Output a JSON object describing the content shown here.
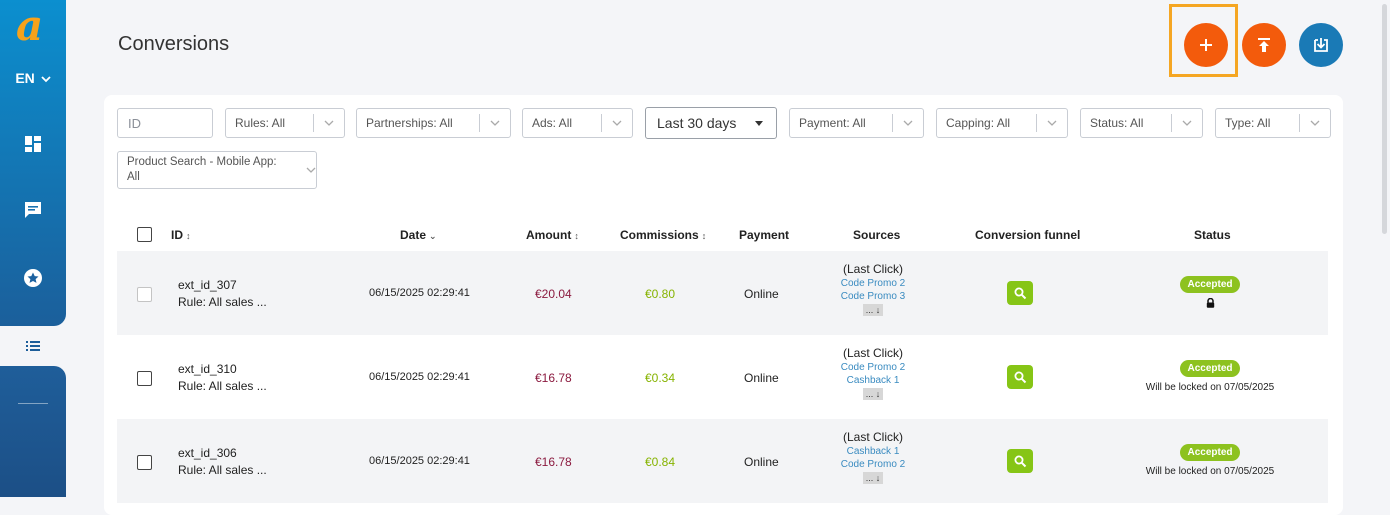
{
  "sidebar": {
    "language": "EN"
  },
  "header": {
    "title": "Conversions"
  },
  "filters": {
    "id_placeholder": "ID",
    "rules": "Rules: All",
    "partnerships": "Partnerships: All",
    "ads": "Ads: All",
    "date_range": "Last 30 days",
    "payment": "Payment: All",
    "capping": "Capping: All",
    "status": "Status: All",
    "type": "Type: All",
    "product_search_line1": "Product Search - Mobile App:",
    "product_search_line2": "All"
  },
  "table": {
    "columns": {
      "id": "ID",
      "date": "Date",
      "amount": "Amount",
      "commissions": "Commissions",
      "payment": "Payment",
      "sources": "Sources",
      "funnel": "Conversion funnel",
      "status": "Status"
    },
    "rows": [
      {
        "id": "ext_id_307",
        "rule": "Rule: All sales ...",
        "date": "06/15/2025 02:29:41",
        "amount": "€20.04",
        "commission": "€0.80",
        "payment": "Online",
        "source_head": "(Last Click)",
        "source_1": "Code Promo 2",
        "source_2": "Code Promo 3",
        "more": "... ↓",
        "status": "Accepted",
        "lock_note": ""
      },
      {
        "id": "ext_id_310",
        "rule": "Rule: All sales ...",
        "date": "06/15/2025 02:29:41",
        "amount": "€16.78",
        "commission": "€0.34",
        "payment": "Online",
        "source_head": "(Last Click)",
        "source_1": "Code Promo 2",
        "source_2": "Cashback 1",
        "more": "... ↓",
        "status": "Accepted",
        "lock_note": "Will be locked on 07/05/2025"
      },
      {
        "id": "ext_id_306",
        "rule": "Rule: All sales ...",
        "date": "06/15/2025 02:29:41",
        "amount": "€16.78",
        "commission": "€0.84",
        "payment": "Online",
        "source_head": "(Last Click)",
        "source_1": "Cashback 1",
        "source_2": "Code Promo 2",
        "more": "... ↓",
        "status": "Accepted",
        "lock_note": "Will be locked on 07/05/2025"
      }
    ]
  },
  "colors": {
    "brand_orange": "#f35b0c",
    "brand_blue": "#1a7ab6",
    "accepted_green": "#8dc21f",
    "amount": "#8b1a3f",
    "commission": "#86b300",
    "highlight": "#f5a623"
  },
  "icons": {
    "logo": "affiliate-logo-icon",
    "add": "plus-icon",
    "export": "upload-icon",
    "import": "download-icon",
    "dashboard": "dashboard-icon",
    "messages": "chat-icon",
    "favorites": "star-icon",
    "list": "list-icon",
    "funnel": "magnifier-icon",
    "locked": "lock-icon"
  }
}
